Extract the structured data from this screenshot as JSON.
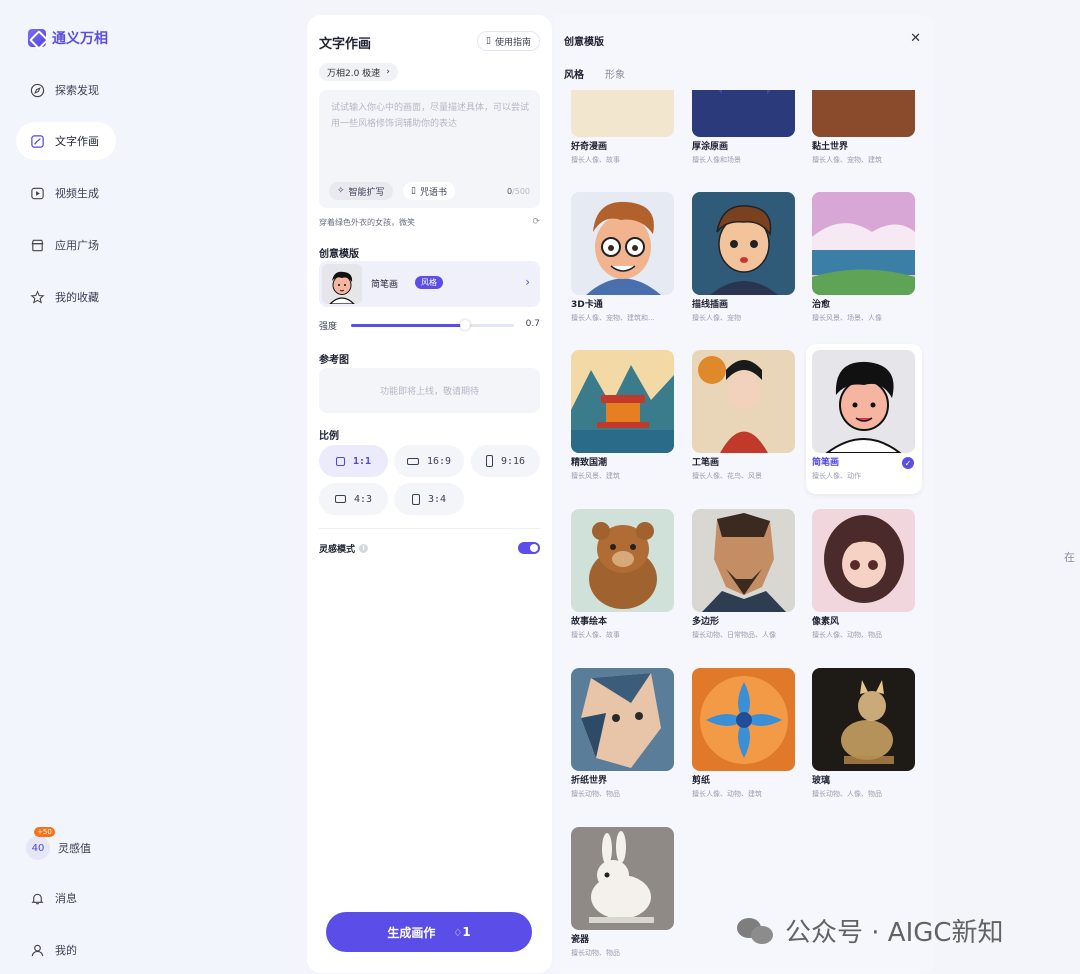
{
  "app": {
    "name": "通义万相"
  },
  "nav": {
    "items": [
      {
        "label": "探索发现",
        "icon": "compass-icon"
      },
      {
        "label": "文字作画",
        "icon": "image-edit-icon",
        "active": true
      },
      {
        "label": "视频生成",
        "icon": "video-icon"
      },
      {
        "label": "应用广场",
        "icon": "store-icon"
      },
      {
        "label": "我的收藏",
        "icon": "star-icon"
      }
    ],
    "credits": {
      "value": "40",
      "badge": "+50",
      "label": "灵感值"
    },
    "messages": "消息",
    "profile": "我的"
  },
  "panel": {
    "title": "文字作画",
    "guide": "使用指南",
    "model": "万相2.0 极速",
    "prompt": {
      "placeholder": "试试输入你心中的画面，尽量描述具体，可以尝试用一些风格修饰词辅助你的表达",
      "ai_expand": "智能扩写",
      "spellbook": "咒语书",
      "count": "0",
      "max": "/500"
    },
    "suggestion": "穿着绿色外衣的女孩，微笑",
    "template_section": "创意模版",
    "template": {
      "name": "简笔画",
      "tag": "风格"
    },
    "strength": {
      "label": "强度",
      "value": "0.7",
      "fraction": 0.7
    },
    "reference": {
      "label": "参考图",
      "placeholder": "功能即将上线，敬请期待"
    },
    "ratio": {
      "label": "比例",
      "options": [
        "1:1",
        "16:9",
        "9:16",
        "4:3",
        "3:4"
      ],
      "selected": "1:1"
    },
    "inspiration": {
      "label": "灵感模式",
      "on": true
    },
    "generate": {
      "label": "生成画作",
      "cost": "1"
    }
  },
  "gallery": {
    "title": "创意模版",
    "tabs": [
      "风格",
      "形象"
    ],
    "cards": [
      {
        "name": "好奇漫画",
        "desc": "擅长人像、故事"
      },
      {
        "name": "厚涂原画",
        "desc": "擅长人像和场景"
      },
      {
        "name": "黏土世界",
        "desc": "擅长人像、宠物、建筑"
      },
      {
        "name": "3D卡通",
        "desc": "擅长人像、宠物、建筑和..."
      },
      {
        "name": "描线插画",
        "desc": "擅长人像、宠物"
      },
      {
        "name": "治愈",
        "desc": "擅长风景、场景、人像"
      },
      {
        "name": "精致国潮",
        "desc": "擅长风景、建筑"
      },
      {
        "name": "工笔画",
        "desc": "擅长人像、花鸟、风景"
      },
      {
        "name": "简笔画",
        "desc": "擅长人像、动作",
        "selected": true
      },
      {
        "name": "故事绘本",
        "desc": "擅长人像、故事"
      },
      {
        "name": "多边形",
        "desc": "擅长动物、日常物品、人像"
      },
      {
        "name": "像素风",
        "desc": "擅长人像、动物、物品"
      },
      {
        "name": "折纸世界",
        "desc": "擅长动物、物品"
      },
      {
        "name": "剪纸",
        "desc": "擅长人像、动物、建筑"
      },
      {
        "name": "玻璃",
        "desc": "擅长动物、人像、物品"
      },
      {
        "name": "瓷器",
        "desc": "擅长动物、物品"
      }
    ]
  },
  "right_hint": "在",
  "watermark": "公众号 · AIGC新知",
  "colors": {
    "accent": "#5b4ee8",
    "nav_bg": "#f3f5fc",
    "panel_bg": "#ffffff"
  }
}
